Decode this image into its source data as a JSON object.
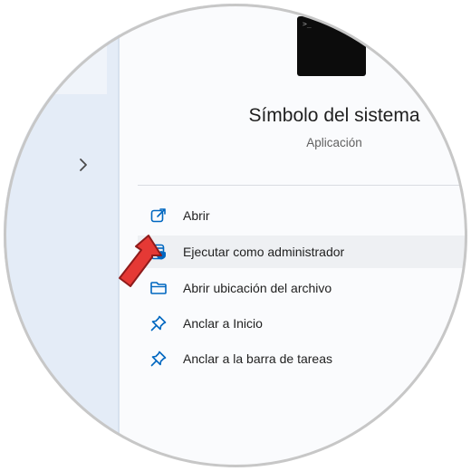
{
  "app": {
    "title": "Símbolo del sistema",
    "subtitle": "Aplicación",
    "icon": "command-prompt-icon"
  },
  "menu": {
    "items": [
      {
        "label": "Abrir",
        "icon": "open-external-icon"
      },
      {
        "label": "Ejecutar como administrador",
        "icon": "run-as-admin-icon",
        "highlighted": true
      },
      {
        "label": "Abrir ubicación del archivo",
        "icon": "folder-icon"
      },
      {
        "label": "Anclar a Inicio",
        "icon": "pin-icon"
      },
      {
        "label": "Anclar a la barra de tareas",
        "icon": "pin-icon"
      }
    ]
  },
  "colors": {
    "accent": "#0067c0",
    "arrow": "#e53935",
    "icon_bg": "#0c0c0c"
  },
  "annotation": {
    "icon": "red-pointer-arrow"
  }
}
